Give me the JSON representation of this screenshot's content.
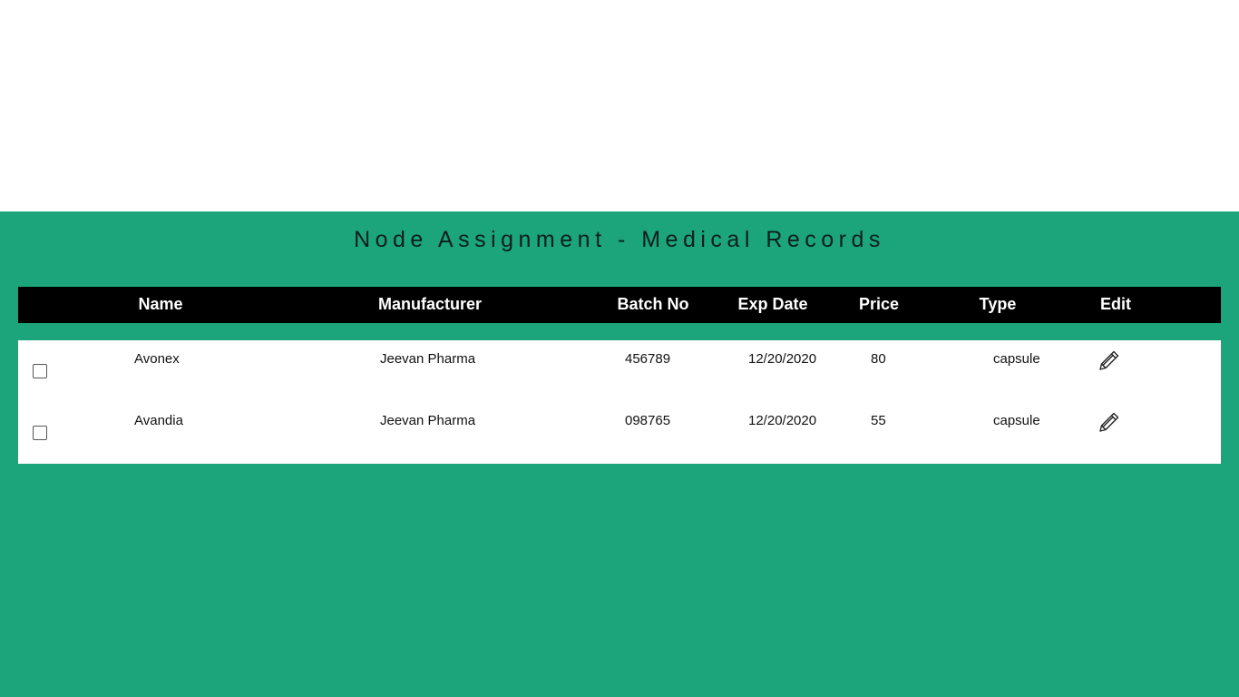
{
  "page": {
    "title": "Node Assignment - Medical Records"
  },
  "table": {
    "headers": [
      "Name",
      "Manufacturer",
      "Batch No",
      "Exp Date",
      "Price",
      "Type",
      "Edit"
    ],
    "rows": [
      {
        "checked": false,
        "name": "Avonex",
        "manufacturer": "Jeevan Pharma",
        "batch_no": "456789",
        "exp_date": "12/20/2020",
        "price": "80",
        "type": "capsule",
        "edit_icon": "pencil-icon"
      },
      {
        "checked": false,
        "name": "Avandia",
        "manufacturer": "Jeevan Pharma",
        "batch_no": "098765",
        "exp_date": "12/20/2020",
        "price": "55",
        "type": "capsule",
        "edit_icon": "pencil-icon"
      }
    ]
  },
  "colors": {
    "background": "#1ca57b",
    "header_bg": "#000000",
    "header_text": "#ffffff",
    "body_bg": "#ffffff"
  }
}
